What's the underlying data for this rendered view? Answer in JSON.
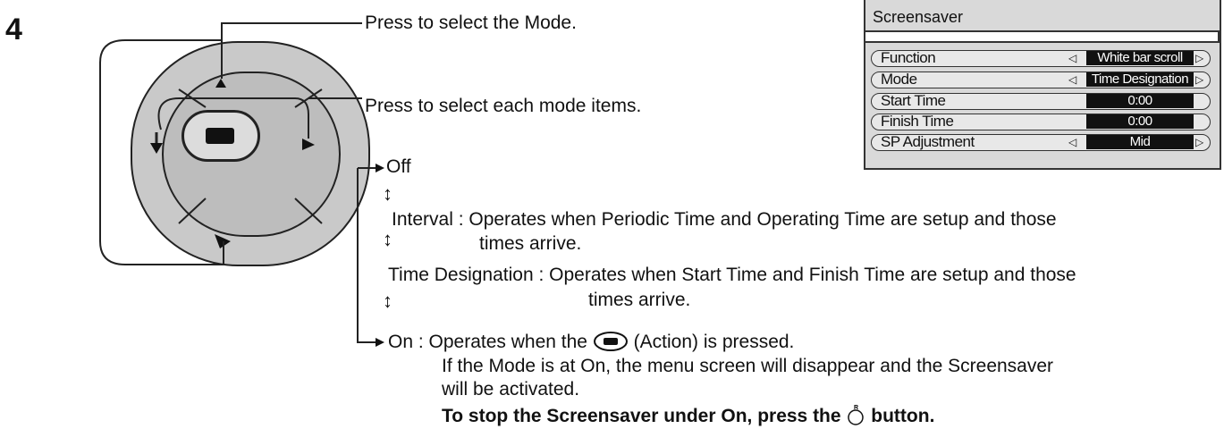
{
  "step_number": "4",
  "callouts": {
    "select_mode": "Press to select the Mode.",
    "select_items": "Press to select each mode items."
  },
  "modes": {
    "off": "Off",
    "interval_line1": "Interval : Operates when Periodic Time and Operating Time are setup and those",
    "interval_line2": "times arrive.",
    "time_line1": "Time Designation : Operates when Start Time and Finish Time are setup and those",
    "time_line2": "times arrive.",
    "on_prefix": "On : Operates when the",
    "on_suffix": "(Action) is pressed.",
    "on_note1": "If the Mode is at On, the menu screen will disappear and the Screensaver",
    "on_note2": "will be activated.",
    "stop_prefix": "To stop the Screensaver under On, press the",
    "stop_suffix": "button."
  },
  "osd": {
    "title": "Screensaver",
    "rows": [
      {
        "label": "Function",
        "value": "White bar scroll",
        "arrows": true
      },
      {
        "label": "Mode",
        "value": "Time Designation",
        "arrows": true
      },
      {
        "label": "Start Time",
        "value": "0:00",
        "arrows": false
      },
      {
        "label": "Finish Time",
        "value": "0:00",
        "arrows": false
      },
      {
        "label": "SP Adjustment",
        "value": "Mid",
        "arrows": true
      }
    ]
  },
  "icons": {
    "action_button": "action-button-icon",
    "return_button": "return-button-icon"
  }
}
